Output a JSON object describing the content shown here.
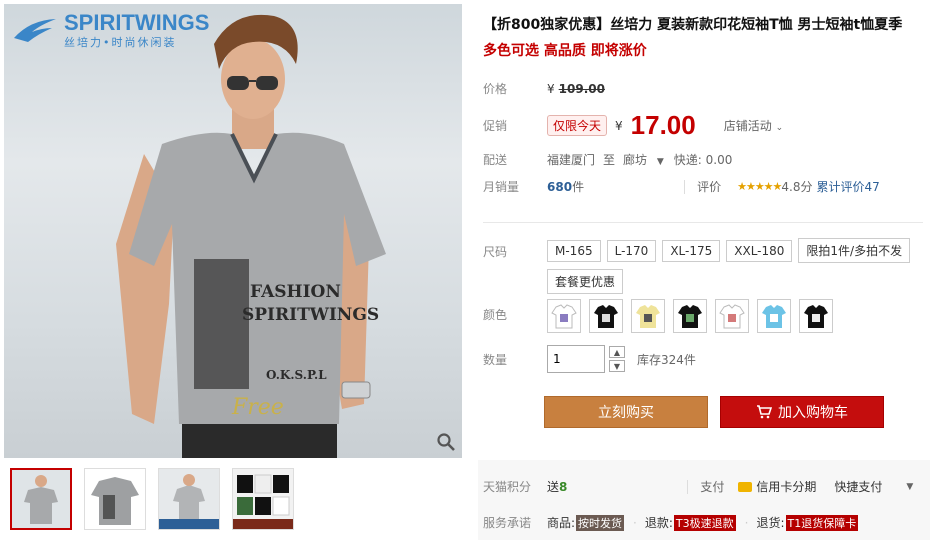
{
  "brand": {
    "name": "SPIRITWINGS",
    "tagline": "丝培力•时尚休闲装"
  },
  "product": {
    "title": "【折800独家优惠】丝培力 夏装新款印花短袖T恤 男士短袖t恤夏季",
    "subtitle": "多色可选 高品质 即将涨价"
  },
  "price": {
    "label": "价格",
    "currency": "¥",
    "original": "109.00"
  },
  "promo": {
    "label": "促销",
    "tag": "仅限今天",
    "currency": "¥",
    "price": "17.00",
    "store_activity": "店铺活动"
  },
  "shipping": {
    "label": "配送",
    "from": "福建厦门",
    "to_word": "至",
    "to": "廊坊",
    "fee": "快递: 0.00"
  },
  "sales": {
    "label": "月销量",
    "count": "680",
    "unit": "件",
    "review_label": "评价",
    "stars": "★★★★★",
    "score": "4.8分",
    "total_reviews": "累计评价47"
  },
  "size": {
    "label": "尺码",
    "options": [
      "M-165",
      "L-170",
      "XL-175",
      "XXL-180",
      "限拍1件/多拍不发",
      "套餐更优惠"
    ]
  },
  "color": {
    "label": "颜色",
    "swatches": [
      "#ffffff",
      "#111111",
      "#efe39a",
      "#111111",
      "#ffffff",
      "#6cc3e6",
      "#111111"
    ]
  },
  "quantity": {
    "label": "数量",
    "value": "1",
    "stock": "库存324件"
  },
  "buttons": {
    "buy_now": "立刻购买",
    "add_cart": "加入购物车"
  },
  "points": {
    "label": "天猫积分",
    "give": "送",
    "value": "8"
  },
  "payment": {
    "label": "支付",
    "card": "信用卡分期",
    "quick": "快捷支付"
  },
  "service": {
    "label": "服务承诺",
    "item_goods": "商品:",
    "badge_ship": "按时发货",
    "item_refund": "退款:",
    "badge_refund": "T3极速退款",
    "item_return": "退货:",
    "badge_return": "T1退货保障卡"
  }
}
